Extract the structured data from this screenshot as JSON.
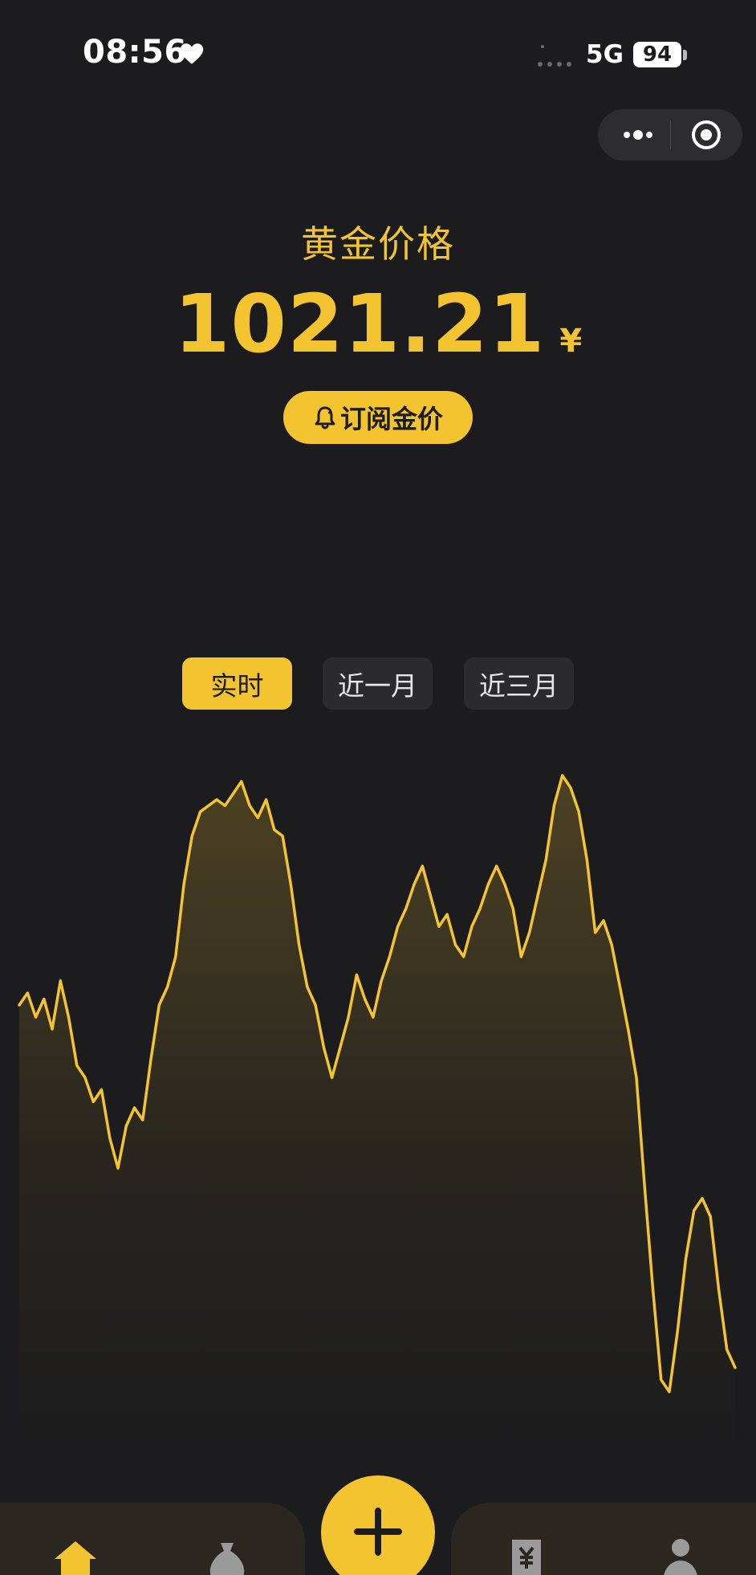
{
  "status_bar": {
    "time": "08:56",
    "network": "5G",
    "battery": "94"
  },
  "header": {
    "title": "黄金价格",
    "price": "1021.21",
    "currency": "¥",
    "subscribe_label": "订阅金价"
  },
  "tabs": [
    {
      "label": "实时",
      "active": true
    },
    {
      "label": "近一月",
      "active": false
    },
    {
      "label": "近三月",
      "active": false
    }
  ],
  "colors": {
    "accent": "#f4c430",
    "background": "#1c1c1e",
    "nav_background": "#2a2620"
  },
  "icons": {
    "status": [
      "heart-icon",
      "signal-icon"
    ],
    "capsule": [
      "more-icon",
      "target-icon"
    ],
    "subscribe": "bell-icon",
    "nav": [
      "home-icon",
      "money-bag-icon",
      "add-icon",
      "receipt-icon",
      "user-icon"
    ]
  },
  "chart_data": {
    "type": "area",
    "series": [
      {
        "values": [
          0.72,
          0.74,
          0.7,
          0.73,
          0.68,
          0.76,
          0.7,
          0.62,
          0.6,
          0.56,
          0.58,
          0.5,
          0.45,
          0.52,
          0.55,
          0.53,
          0.63,
          0.72,
          0.75,
          0.8,
          0.92,
          1.0,
          1.04,
          1.05,
          1.06,
          1.05,
          1.07,
          1.09,
          1.05,
          1.03,
          1.06,
          1.01,
          1.0,
          0.92,
          0.82,
          0.75,
          0.72,
          0.65,
          0.6,
          0.65,
          0.7,
          0.77,
          0.73,
          0.7,
          0.76,
          0.8,
          0.85,
          0.88,
          0.92,
          0.95,
          0.9,
          0.85,
          0.87,
          0.82,
          0.8,
          0.85,
          0.88,
          0.92,
          0.95,
          0.92,
          0.88,
          0.8,
          0.84,
          0.9,
          0.96,
          1.05,
          1.1,
          1.08,
          1.04,
          0.96,
          0.84,
          0.86,
          0.82,
          0.75,
          0.68,
          0.6,
          0.42,
          0.25,
          0.1,
          0.08,
          0.18,
          0.3,
          0.38,
          0.4,
          0.37,
          0.25,
          0.15,
          0.12
        ]
      }
    ]
  }
}
